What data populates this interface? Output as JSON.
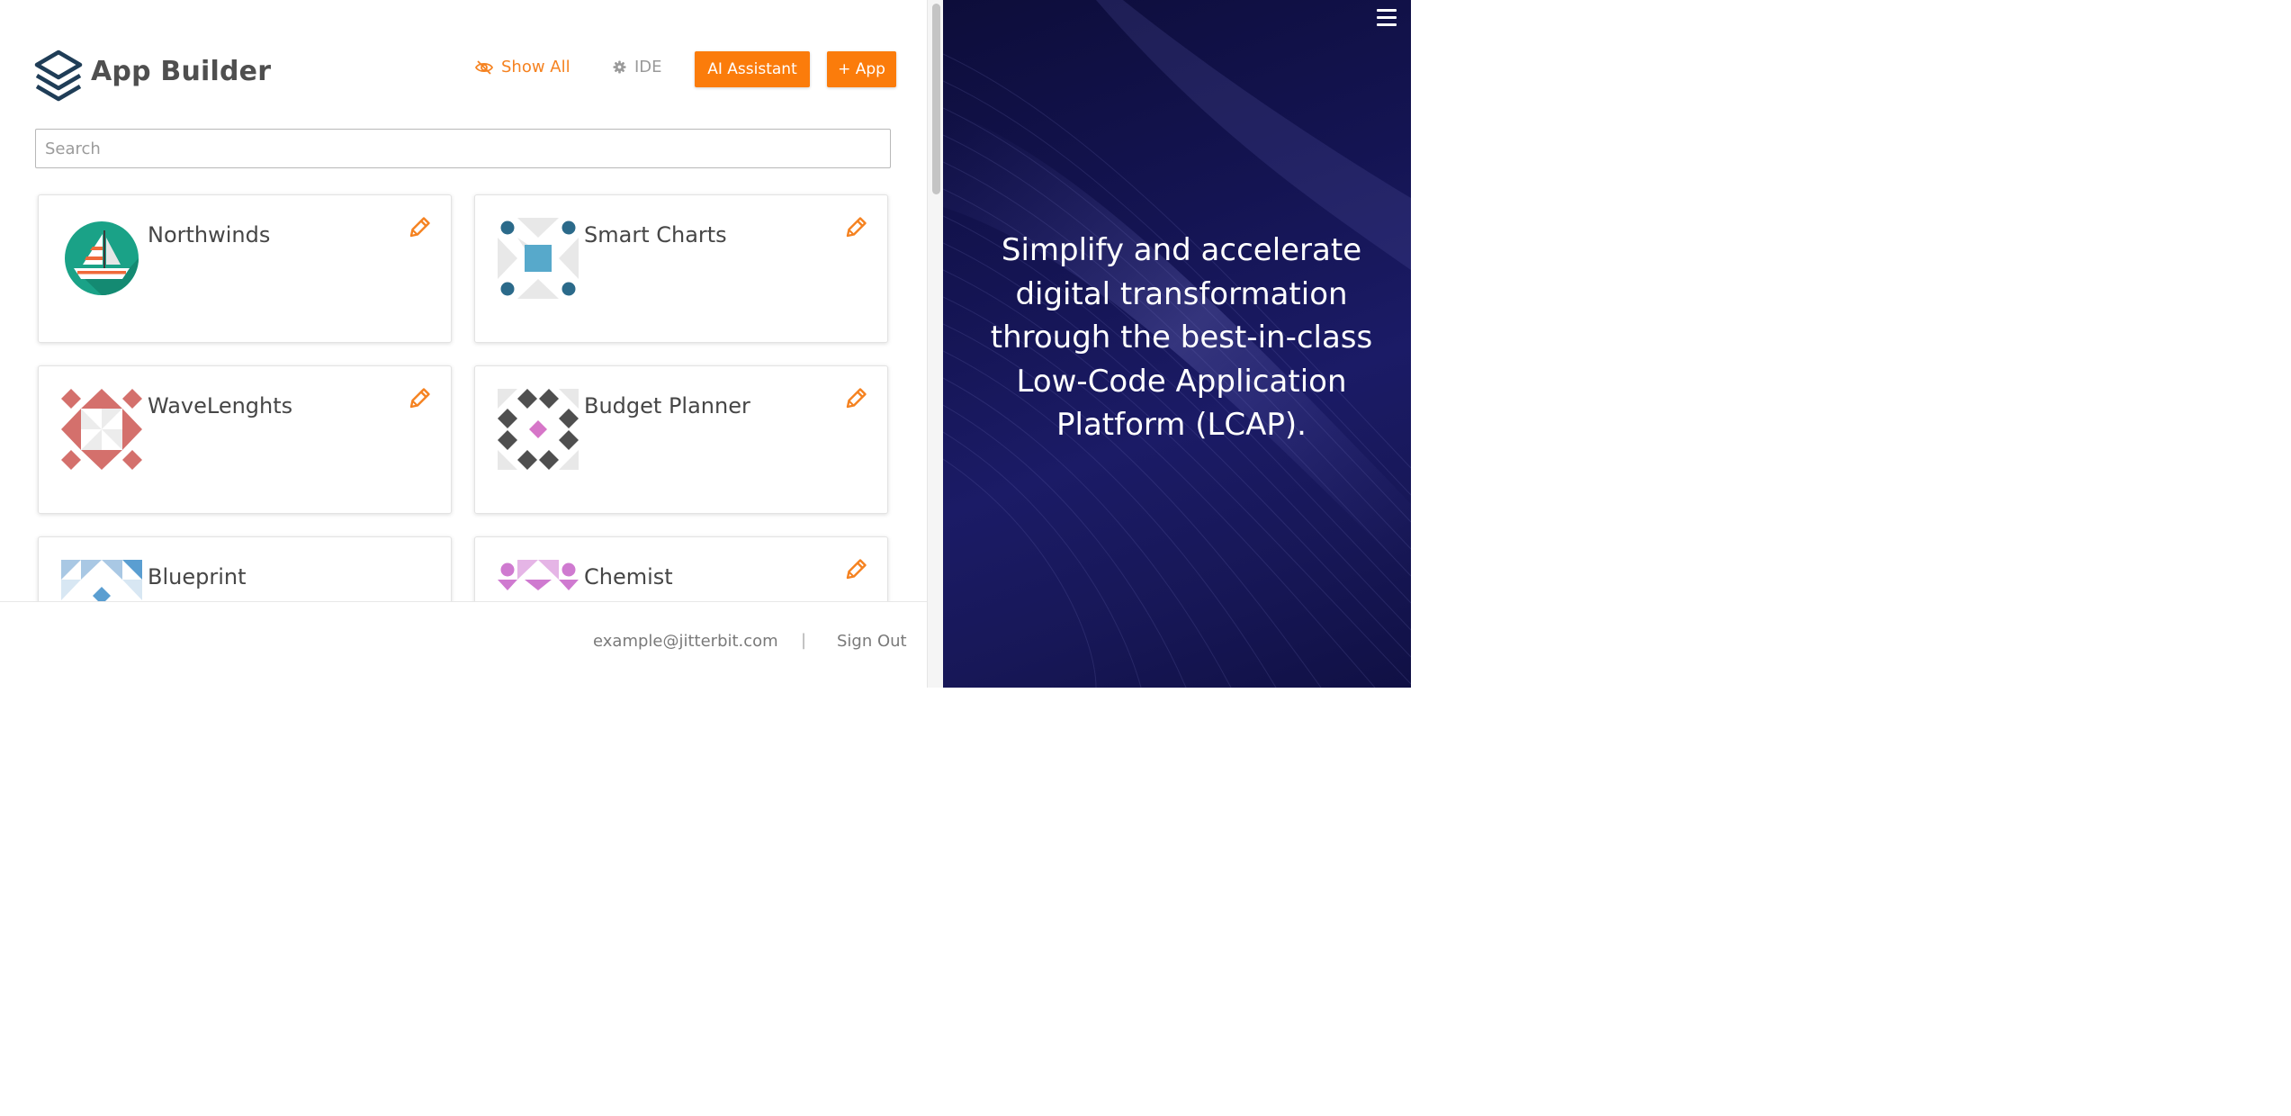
{
  "header": {
    "title": "App Builder",
    "show_all_label": "Show All",
    "ide_label": "IDE",
    "ai_assistant_label": "AI Assistant",
    "add_app_label": "+ App",
    "accent_color": "#fb7c0b"
  },
  "search": {
    "placeholder": "Search",
    "value": ""
  },
  "apps": [
    {
      "name": "Northwinds",
      "icon": "sailboat-icon",
      "editable": true
    },
    {
      "name": "Smart Charts",
      "icon": "identicon-blue-icon",
      "editable": true
    },
    {
      "name": "WaveLenghts",
      "icon": "identicon-red-icon",
      "editable": true
    },
    {
      "name": "Budget Planner",
      "icon": "identicon-gray-icon",
      "editable": true
    },
    {
      "name": "Blueprint",
      "icon": "identicon-lightblue-icon",
      "editable": false
    },
    {
      "name": "Chemist",
      "icon": "identicon-pink-icon",
      "editable": true
    }
  ],
  "footer": {
    "email": "example@jitterbit.com",
    "separator": "|",
    "sign_out_label": "Sign Out"
  },
  "promo": {
    "tagline": "Simplify and accelerate digital transformation through the best-in-class Low-Code Application Platform (LCAP)."
  }
}
